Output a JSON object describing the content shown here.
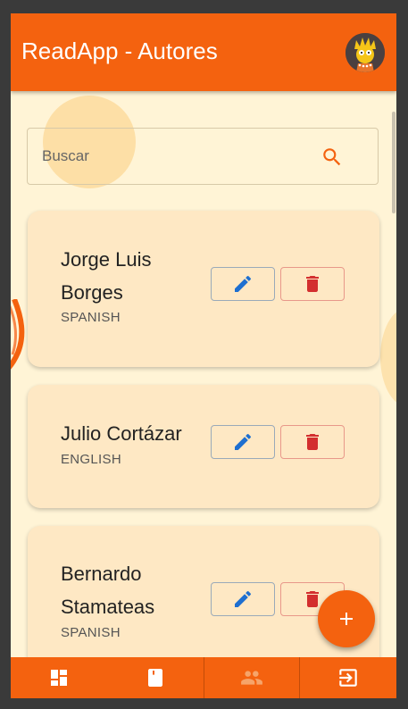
{
  "appbar": {
    "title": "ReadApp - Autores"
  },
  "search": {
    "placeholder": "Buscar",
    "value": ""
  },
  "authors": [
    {
      "name_line1": "Jorge Luis",
      "name_line2": "Borges",
      "language": "SPANISH"
    },
    {
      "name_line1": "Julio Cortázar",
      "name_line2": "",
      "language": "ENGLISH"
    },
    {
      "name_line1": "Bernardo",
      "name_line2": "Stamateas",
      "language": "SPANISH"
    }
  ],
  "icons": {
    "avatar": "user-avatar",
    "search": "search-icon",
    "edit": "pencil-icon",
    "delete": "trash-icon",
    "fab": "plus-icon",
    "nav": [
      "dashboard-icon",
      "book-icon",
      "people-icon",
      "logout-icon"
    ]
  },
  "colors": {
    "primary": "#f4620f",
    "background": "#fff4d6",
    "card": "#fee8c4",
    "edit": "#1e6fd0",
    "delete": "#d32f2f",
    "nav_active": "#f6a46a"
  },
  "bottom_nav": {
    "active_index": 2
  }
}
